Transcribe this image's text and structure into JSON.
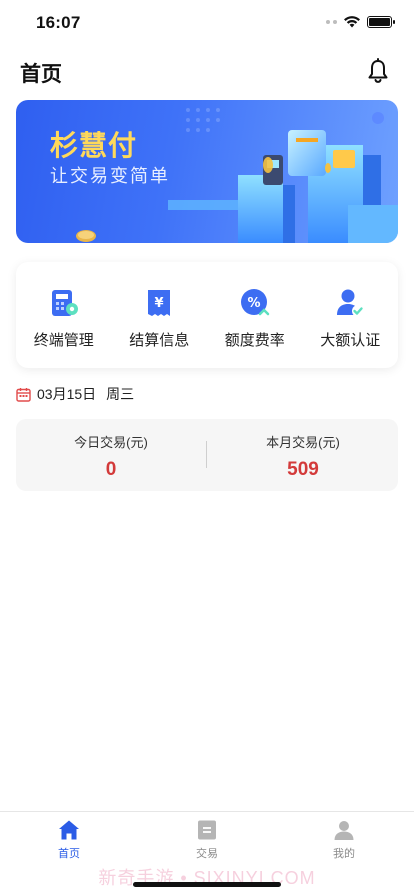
{
  "status_bar": {
    "time": "16:07"
  },
  "header": {
    "title": "首页"
  },
  "banner": {
    "title": "杉慧付",
    "subtitle": "让交易变简单"
  },
  "menu": {
    "items": [
      {
        "label": "终端管理",
        "icon": "terminal-icon"
      },
      {
        "label": "结算信息",
        "icon": "settlement-icon"
      },
      {
        "label": "额度费率",
        "icon": "rate-icon"
      },
      {
        "label": "大额认证",
        "icon": "verify-user-icon"
      }
    ]
  },
  "date": {
    "date": "03月15日",
    "weekday": "周三"
  },
  "stats": {
    "today_label": "今日交易(元)",
    "today_value": "0",
    "month_label": "本月交易(元)",
    "month_value": "509"
  },
  "tab_bar": {
    "tabs": [
      {
        "label": "首页",
        "icon": "home-icon",
        "active": true
      },
      {
        "label": "交易",
        "icon": "transaction-icon",
        "active": false
      },
      {
        "label": "我的",
        "icon": "profile-icon",
        "active": false
      }
    ],
    "watermark": "新奇手游 • SIXINYI.COM"
  },
  "colors": {
    "accent": "#2b5ce6",
    "value_red": "#d33a3a",
    "banner_yellow": "#ffd95a"
  }
}
